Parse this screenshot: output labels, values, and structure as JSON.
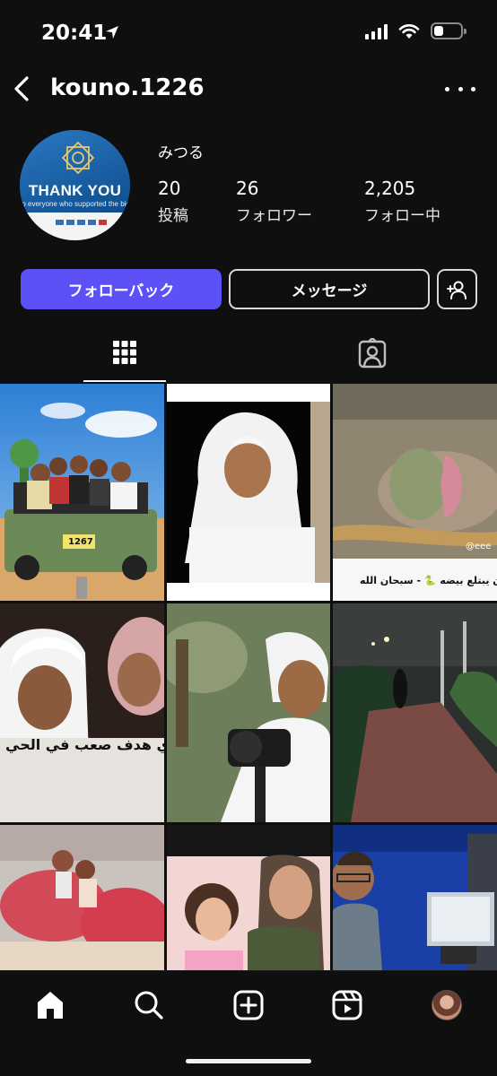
{
  "status_bar": {
    "time": "20:41",
    "battery_level": 0.35
  },
  "header": {
    "username": "kouno.1226"
  },
  "profile": {
    "avatar": {
      "title": "THANK YOU",
      "subtitle": "to everyone who supported the bid"
    },
    "display_name": "みつる",
    "stats": [
      {
        "value": "20",
        "label": "投稿"
      },
      {
        "value": "26",
        "label": "フォロワー"
      },
      {
        "value": "2,205",
        "label": "フォロー中"
      }
    ]
  },
  "actions": {
    "follow_back": "フォローバック",
    "message": "メッセージ"
  },
  "posts": {
    "captions": {
      "jeep_plate": "1267",
      "snake_watermark": "@eee",
      "snake_caption": "ثعبان يبتلع بيضه 🐍 - سبحان الله",
      "selfie_caption": "ي هدف صعب في الحي"
    }
  },
  "colors": {
    "background": "#0f0f10",
    "accent": "#5b51f5",
    "text": "#ffffff"
  },
  "icons": {
    "status": [
      "location-arrow-icon",
      "signal-icon",
      "wifi-icon",
      "battery-icon"
    ],
    "nav": [
      "home-icon",
      "search-icon",
      "create-icon",
      "reels-icon",
      "profile-avatar"
    ]
  }
}
